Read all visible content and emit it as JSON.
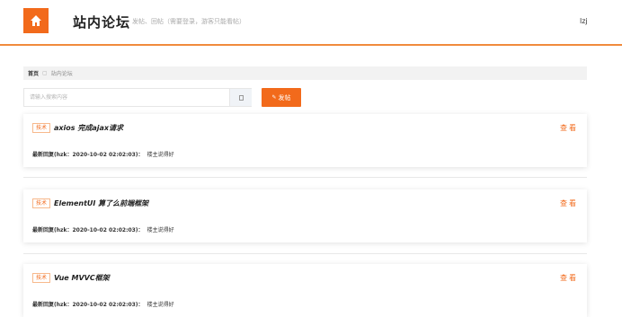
{
  "header": {
    "home_icon": "home-icon",
    "title": "站内论坛",
    "subtitle": "发帖、回帖（需要登录，游客只能看帖）",
    "username": "lzj",
    "accent": "#f26a1b"
  },
  "breadcrumb": {
    "home": "首页",
    "current": "站内论坛"
  },
  "search": {
    "placeholder": "请输入搜索内容",
    "button_icon": "search-icon"
  },
  "post_button": {
    "label": "发帖",
    "icon": "pencil-icon"
  },
  "posts": [
    {
      "tag": "技术",
      "title": "axios 完成ajax请求",
      "view_label": "查看",
      "reply_meta": "最新回复(hzk：2020-10-02 02:02:03)：",
      "reply_text": "楼主说得好"
    },
    {
      "tag": "技术",
      "title": "ElementUI 算了么前端框架",
      "view_label": "查看",
      "reply_meta": "最新回复(hzk：2020-10-02 02:02:03)：",
      "reply_text": "楼主说得好"
    },
    {
      "tag": "技术",
      "title": "Vue MVVC框架",
      "view_label": "查看",
      "reply_meta": "最新回复(hzk：2020-10-02 02:02:03)：",
      "reply_text": "楼主说得好"
    }
  ]
}
